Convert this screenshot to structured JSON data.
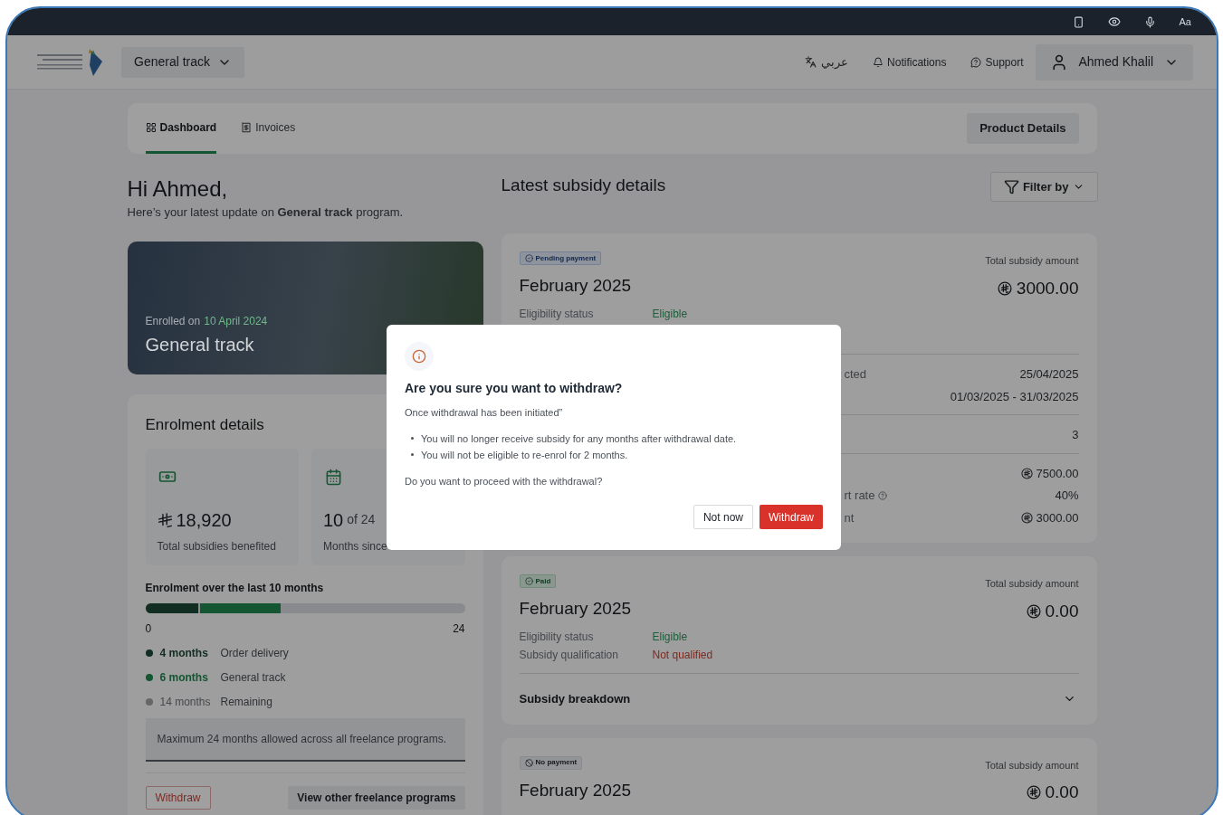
{
  "system_bar": {
    "text_size": "Aa"
  },
  "header": {
    "track_selector": "General track",
    "language": "عربي",
    "notifications": "Notifications",
    "support": "Support",
    "user": "Ahmed Khalil"
  },
  "tabs": [
    {
      "label": "Dashboard",
      "selected": true
    },
    {
      "label": "Invoices",
      "selected": false
    }
  ],
  "product_details": "Product Details",
  "greeting": {
    "title": "Hi Ahmed,",
    "subtitle": "Here’s your latest update on **General track** program."
  },
  "hero": {
    "enrolled_label": "Enrolled on",
    "enrolled_date": "10 April 2024",
    "title": "General track"
  },
  "enrolment": {
    "title": "Enrolment details",
    "stats": [
      {
        "kind": "money",
        "value": "18,920",
        "label": "Total subsidies benefited"
      },
      {
        "kind": "calendar",
        "value": "10",
        "suffix": "of 24",
        "label": "Months since"
      }
    ],
    "chart_title": "Enrolment over the last 10 months",
    "axis_min": "0",
    "axis_max": "24",
    "legend": [
      {
        "kind": "used",
        "value": "4 months",
        "label": "Order delivery",
        "color": "#122e22",
        "level": 0.1667
      },
      {
        "kind": "used",
        "value": "6 months",
        "label": "General track",
        "color": "#135631",
        "level": 0.25
      },
      {
        "kind": "remaining",
        "value": "14 months",
        "label": "Remaining",
        "color": "#656769"
      }
    ],
    "note": "Maximum 24 months allowed across all freelance programs.",
    "withdraw": "Withdraw",
    "other_programs": "View other freelance programs"
  },
  "subsidy": {
    "title": "Latest subsidy details",
    "filter": "Filter by",
    "cards": [
      {
        "badge": {
          "label": "Pending payment",
          "kind": "pending"
        },
        "month": "February 2025",
        "total_label": "Total subsidy amount",
        "total": "3000.00",
        "rows": [
          {
            "label": "Eligibility status",
            "value": "Eligible",
            "kind": "good"
          }
        ],
        "groups": [
          [
            {
              "label": "cted",
              "value": "25/04/2025"
            },
            {
              "value": "01/03/2025 - 31/03/2025"
            }
          ],
          [
            {
              "value": "3"
            }
          ],
          [
            {
              "value": "7500.00",
              "currency": true
            },
            {
              "label": "rt rate",
              "help": true,
              "value": "40%"
            },
            {
              "label": "nt",
              "value": "3000.00",
              "currency": true
            }
          ]
        ]
      },
      {
        "badge": {
          "label": "Paid",
          "kind": "paid"
        },
        "month": "February 2025",
        "total_label": "Total subsidy amount",
        "total": "0.00",
        "rows": [
          {
            "label": "Eligibility status",
            "value": "Eligible",
            "kind": "good"
          },
          {
            "label": "Subsidy qualification",
            "value": "Not qualified",
            "kind": "bad"
          }
        ],
        "breakdown": "Subsidy breakdown"
      },
      {
        "badge": {
          "label": "No payment",
          "kind": "none"
        },
        "month": "February 2025",
        "total_label": "Total subsidy amount",
        "total": "0.00"
      }
    ]
  },
  "dialog": {
    "title": "Are you sure you want to withdraw?",
    "intro": "Once withdrawal has been initiated”",
    "points": [
      "You will no longer receive subsidy for any months after withdrawal date.",
      "You will not be eligible to re-enrol for 2 months."
    ],
    "question": "Do you want to proceed with the withdrawal?",
    "buttons": [
      {
        "label": "Not now",
        "kind": "secondary"
      },
      {
        "label": "Withdraw",
        "kind": "danger"
      }
    ]
  }
}
